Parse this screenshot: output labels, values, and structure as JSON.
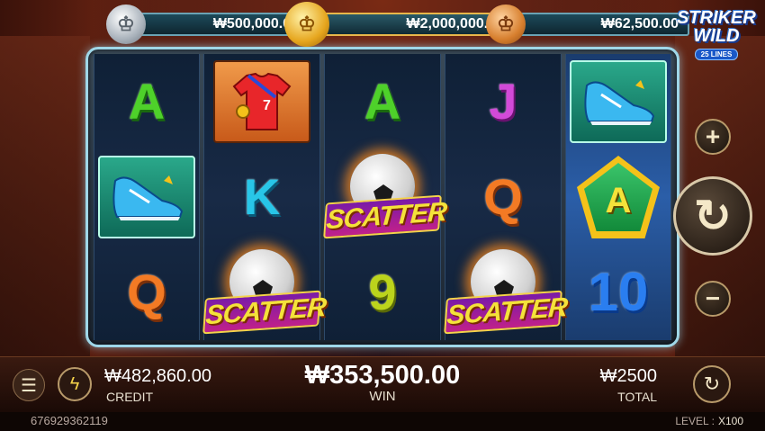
{
  "jackpots": [
    {
      "tier": "silver",
      "amount": "₩500,000.00"
    },
    {
      "tier": "gold",
      "amount": "₩2,000,000.00"
    },
    {
      "tier": "bronze",
      "amount": "₩62,500.00"
    }
  ],
  "logo": {
    "line1": "STRIKER",
    "line2": "WILD",
    "lines": "25 LINES"
  },
  "reels": [
    [
      "A",
      "BOOT",
      "Q"
    ],
    [
      "SHIRT",
      "K",
      "SCATTER"
    ],
    [
      "A",
      "SCATTER",
      "9"
    ],
    [
      "J",
      "Q",
      "SCATTER"
    ],
    [
      "BOOT",
      "A",
      "10"
    ]
  ],
  "scatter_text": "SCATTER",
  "shirt_number": "7",
  "controls": {
    "plus": "+",
    "minus": "−",
    "spin": "↻",
    "menu": "☰",
    "turbo": "ϟ",
    "auto": "↻"
  },
  "credit": {
    "value": "₩482,860.00",
    "label": "CREDIT"
  },
  "win": {
    "value": "₩353,500.00",
    "label": "WIN"
  },
  "total": {
    "value": "₩2500",
    "label": "TOTAL"
  },
  "session_id": "676929362119",
  "level": {
    "label": "LEVEL :",
    "value": "X100"
  },
  "colors": {
    "frame": "#9fd7e8",
    "gold": "#f4c21a",
    "scatter_purple": "#7a1aa8"
  }
}
